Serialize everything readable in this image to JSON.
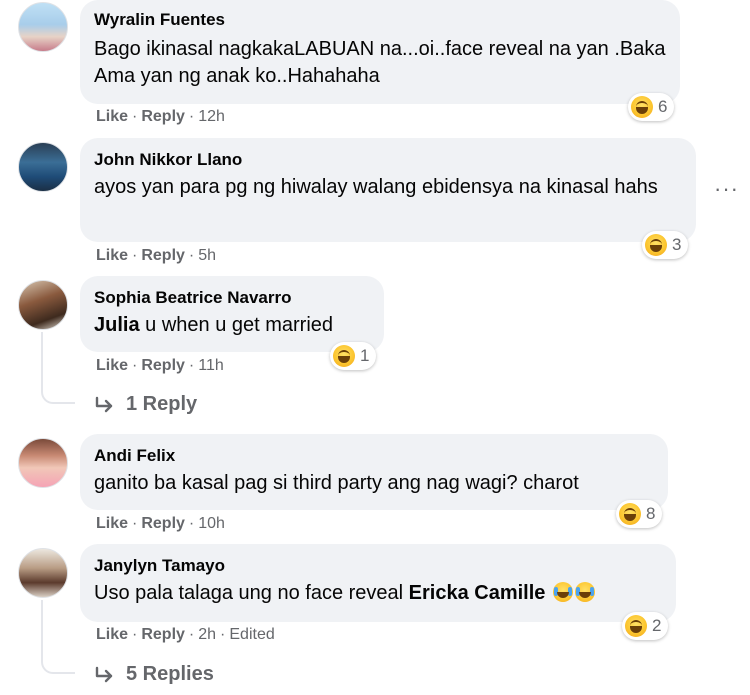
{
  "comments": [
    {
      "author": "Wyralin Fuentes",
      "text": "Bago ikinasal nagkakaLABUAN na...oi..face reveal na yan .Baka Ama yan ng anak ko..Hahahaha",
      "like": "Like",
      "reply": "Reply",
      "time": "12h",
      "reaction_count": "6"
    },
    {
      "author": "John Nikkor Llano",
      "text": "ayos yan para pg ng hiwalay walang ebidensya na kinasal hahs",
      "like": "Like",
      "reply": "Reply",
      "time": "5h",
      "reaction_count": "3",
      "more_icon": "more-options-icon",
      "more_glyph": "···"
    },
    {
      "author": "Sophia Beatrice Navarro",
      "mention": "Julia",
      "text": "u when u get married",
      "like": "Like",
      "reply": "Reply",
      "time": "11h",
      "reaction_count": "1",
      "replies_label": "1 Reply"
    },
    {
      "author": "Andi Felix",
      "text": "ganito ba kasal pag si third party ang nag wagi? charot",
      "like": "Like",
      "reply": "Reply",
      "time": "10h",
      "reaction_count": "8"
    },
    {
      "author": "Janylyn Tamayo",
      "text": "Uso pala talaga ung no face reveal",
      "mention": "Ericka Camille",
      "like": "Like",
      "reply": "Reply",
      "time": "2h",
      "edited": "Edited",
      "reaction_count": "2",
      "replies_label": "5 Replies"
    }
  ],
  "reaction_icon": "haha-reaction-icon",
  "separator": "·",
  "colors": {
    "bubble": "#f0f2f5",
    "meta_text": "#65676b",
    "name_text": "#050505"
  }
}
